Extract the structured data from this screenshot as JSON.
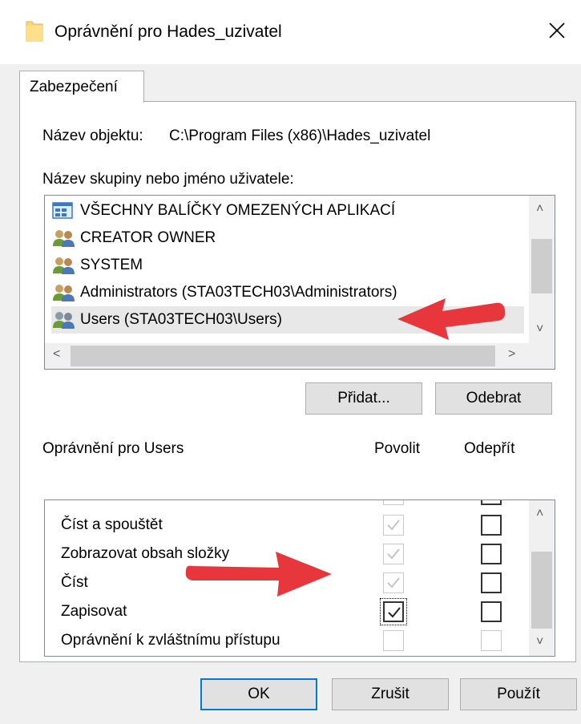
{
  "window": {
    "title": "Oprávnění pro Hades_uzivatel",
    "close_glyph": "✕"
  },
  "tabs": [
    {
      "label": "Zabezpečení",
      "active": true
    }
  ],
  "object": {
    "label": "Název objektu:",
    "value": "C:\\Program Files (x86)\\Hades_uzivatel"
  },
  "groups": {
    "label": "Název skupiny nebo jméno uživatele:",
    "items": [
      {
        "name": "VŠECHNY BALÍČKY OMEZENÝCH APLIKACÍ",
        "icon": "app-package-icon"
      },
      {
        "name": "CREATOR OWNER",
        "icon": "users-group-icon"
      },
      {
        "name": "SYSTEM",
        "icon": "users-group-icon"
      },
      {
        "name": "Administrators (STA03TECH03\\Administrators)",
        "icon": "users-group-icon"
      },
      {
        "name": "Users (STA03TECH03\\Users)",
        "icon": "users-group-icon",
        "selected": true
      }
    ],
    "add_label": "Přidat...",
    "remove_label": "Odebrat"
  },
  "permissions": {
    "label": "Oprávnění pro Users",
    "allow_header": "Povolit",
    "deny_header": "Odepřít",
    "rows": [
      {
        "name": "Číst a spouštět",
        "allow": "checked-disabled",
        "deny": "unchecked"
      },
      {
        "name": "Zobrazovat obsah složky",
        "allow": "checked-disabled",
        "deny": "unchecked"
      },
      {
        "name": "Číst",
        "allow": "checked-disabled",
        "deny": "unchecked"
      },
      {
        "name": "Zapisovat",
        "allow": "checked",
        "deny": "unchecked"
      },
      {
        "name": "Oprávnění k zvláštnímu přístupu",
        "allow": "unchecked-disabled",
        "deny": "unchecked-disabled"
      }
    ]
  },
  "footer": {
    "ok_label": "OK",
    "cancel_label": "Zrušit",
    "apply_label": "Použít"
  },
  "colors": {
    "accent": "#0078d7",
    "annotation_arrow": "#e8373c",
    "dialog_bg": "#f0f0f0"
  }
}
